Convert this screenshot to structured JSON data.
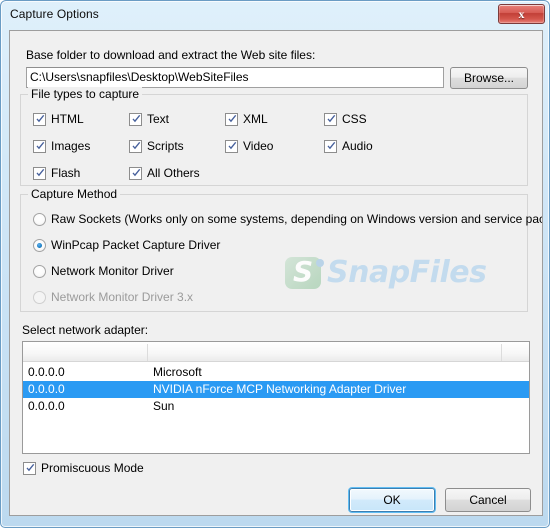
{
  "window": {
    "title": "Capture Options",
    "close_label": "x"
  },
  "base_folder": {
    "label": "Base folder to download and extract the Web site files:",
    "value": "C:\\Users\\snapfiles\\Desktop\\WebSiteFiles",
    "placeholder": "",
    "browse_label": "Browse..."
  },
  "file_types": {
    "group_title": "File types to capture",
    "items": [
      {
        "label": "HTML",
        "checked": true,
        "col": 0,
        "row": 0
      },
      {
        "label": "Text",
        "checked": true,
        "col": 1,
        "row": 0
      },
      {
        "label": "XML",
        "checked": true,
        "col": 2,
        "row": 0
      },
      {
        "label": "CSS",
        "checked": true,
        "col": 3,
        "row": 0
      },
      {
        "label": "Images",
        "checked": true,
        "col": 0,
        "row": 1
      },
      {
        "label": "Scripts",
        "checked": true,
        "col": 1,
        "row": 1
      },
      {
        "label": "Video",
        "checked": true,
        "col": 2,
        "row": 1
      },
      {
        "label": "Audio",
        "checked": true,
        "col": 3,
        "row": 1
      },
      {
        "label": "Flash",
        "checked": true,
        "col": 0,
        "row": 2
      },
      {
        "label": "All Others",
        "checked": true,
        "col": 1,
        "row": 2
      }
    ]
  },
  "capture_method": {
    "group_title": "Capture Method",
    "options": [
      {
        "label": "Raw Sockets  (Works only on some systems, depending on Windows version and service pack)",
        "selected": false,
        "disabled": false
      },
      {
        "label": "WinPcap Packet Capture Driver",
        "selected": true,
        "disabled": false
      },
      {
        "label": "Network Monitor Driver",
        "selected": false,
        "disabled": false
      },
      {
        "label": "Network Monitor Driver 3.x",
        "selected": false,
        "disabled": true
      }
    ]
  },
  "adapter": {
    "label": "Select network adapter:",
    "columns": [
      "",
      "",
      ""
    ],
    "rows": [
      {
        "ip": "0.0.0.0",
        "name": "Microsoft",
        "selected": false
      },
      {
        "ip": "0.0.0.0",
        "name": "NVIDIA nForce MCP Networking Adapter Driver",
        "selected": true
      },
      {
        "ip": "0.0.0.0",
        "name": "Sun",
        "selected": false
      }
    ]
  },
  "promiscuous": {
    "label": "Promiscuous Mode",
    "checked": true
  },
  "buttons": {
    "ok": "OK",
    "cancel": "Cancel"
  },
  "watermark": {
    "text": "SnapFiles"
  },
  "colors": {
    "accent": "#2a9af3",
    "close_button": "#c13f37",
    "title_bar": "#cfe6f7",
    "dialog_bg": "#f0f0f0"
  }
}
